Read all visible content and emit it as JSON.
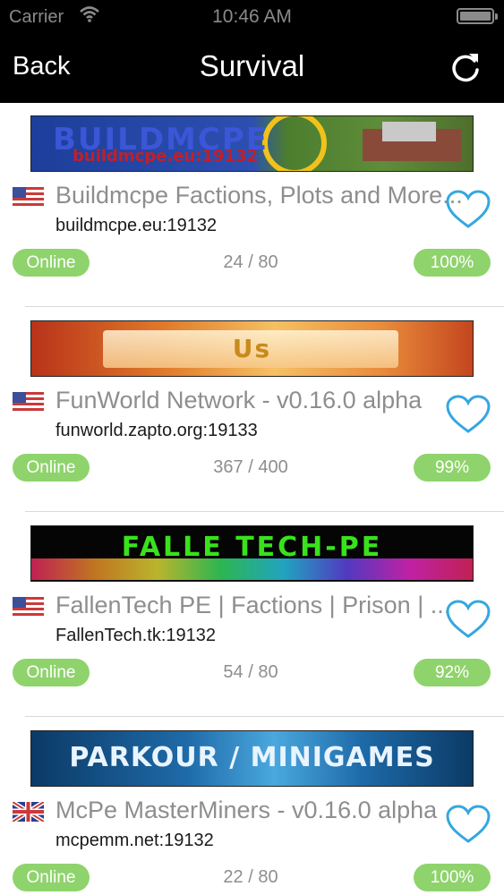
{
  "status_bar": {
    "carrier": "Carrier",
    "time": "10:46 AM"
  },
  "nav": {
    "back_label": "Back",
    "title": "Survival",
    "refresh_icon": "refresh-icon"
  },
  "colors": {
    "online_green": "#8fd36c",
    "heart_blue": "#35a7e0",
    "nav_bg": "#000000"
  },
  "servers": [
    {
      "banner_text": "BUILDMCPE",
      "banner_subtext": "buildmcpe.eu:19132",
      "flag": "us-flag-icon",
      "name": "Buildmcpe Factions, Plots and More...",
      "address": "buildmcpe.eu:19132",
      "status": "Online",
      "players": "24 / 80",
      "uptime": "100%"
    },
    {
      "banner_text": "Us",
      "flag": "us-flag-icon",
      "name": "FunWorld Network - v0.16.0 alpha",
      "address": "funworld.zapto.org:19133",
      "status": "Online",
      "players": "367 / 400",
      "uptime": "99%"
    },
    {
      "banner_text": "FALLE TECH-PE",
      "flag": "us-flag-icon",
      "name": "FallenTech PE | Factions | Prison | ...",
      "address": "FallenTech.tk:19132",
      "status": "Online",
      "players": "54 / 80",
      "uptime": "92%"
    },
    {
      "banner_text": "PARKOUR / MINIGAMES",
      "flag": "uk-flag-icon",
      "name": "McPe MasterMiners - v0.16.0 alpha",
      "address": "mcpemm.net:19132",
      "status": "Online",
      "players": "22 / 80",
      "uptime": "100%"
    }
  ]
}
